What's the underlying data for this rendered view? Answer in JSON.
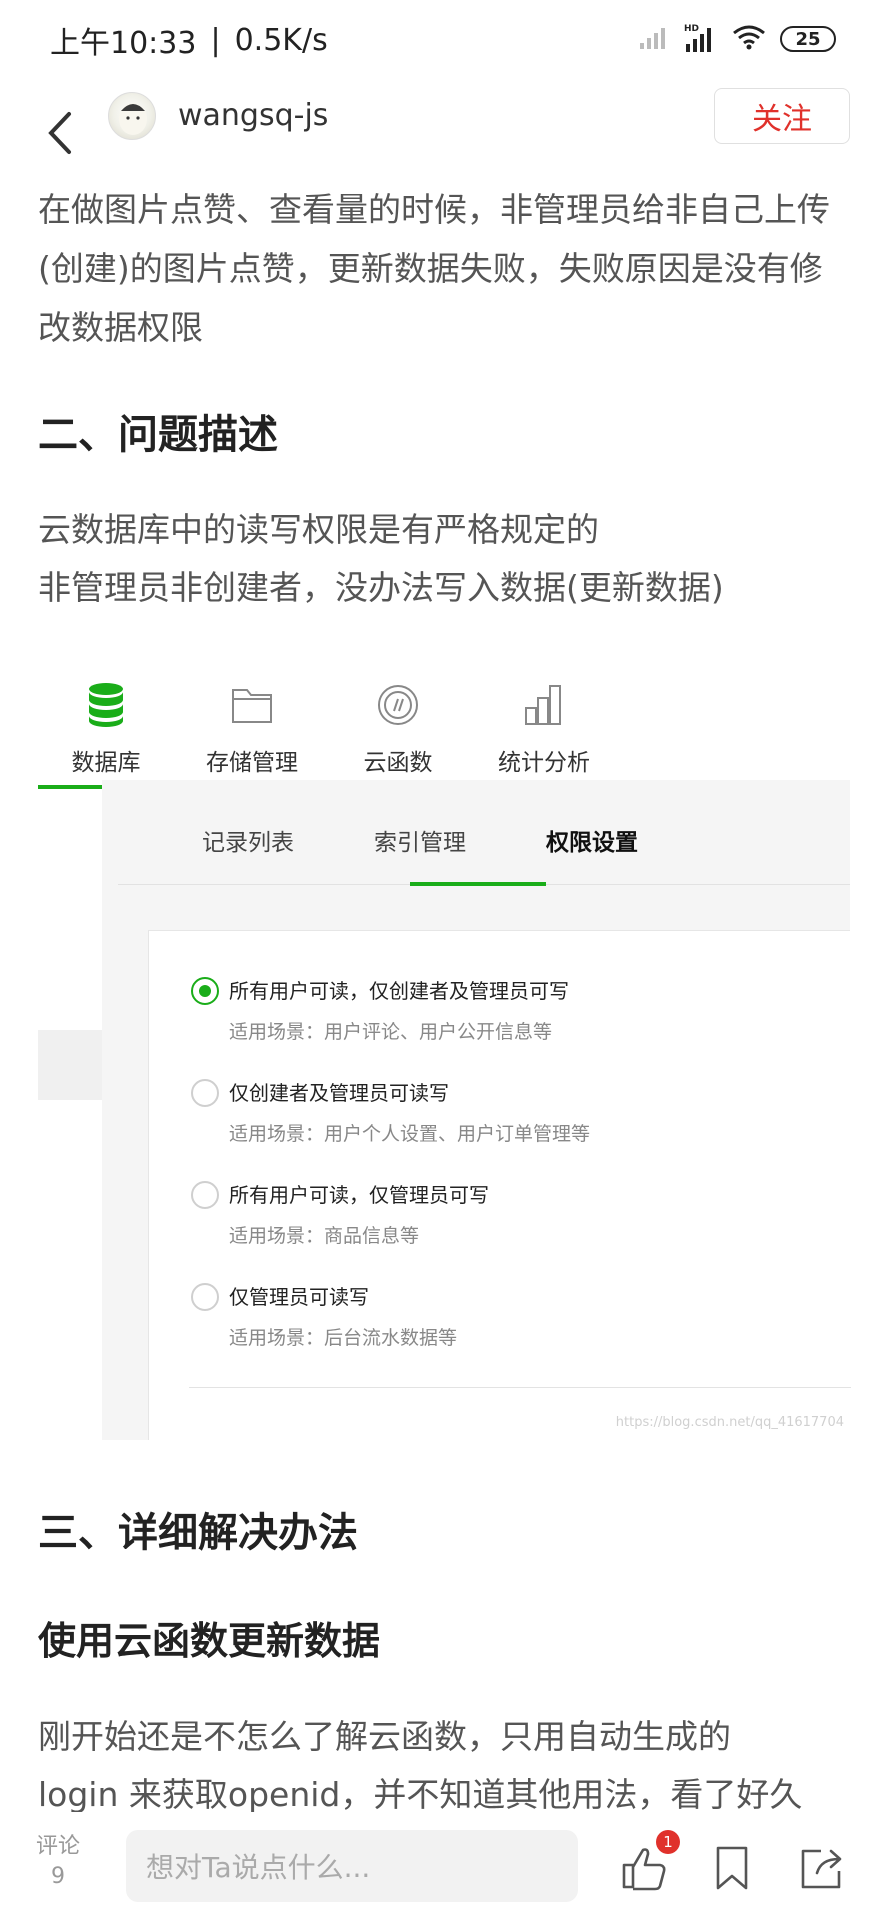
{
  "status_bar": {
    "time": "上午10:33",
    "separator": "|",
    "net_speed": "0.5K/s",
    "battery": "25",
    "icons": [
      "signal-icon",
      "hd-signal-icon",
      "wifi-icon",
      "battery-icon"
    ]
  },
  "header": {
    "username": "wangsq-js",
    "follow_label": "关注"
  },
  "article": {
    "intro": "在做图片点赞、查看量的时候，非管理员给非自己上传(创建)的图片点赞，更新数据失败，失败原因是没有修改数据权限",
    "section2_title": "二、问题描述",
    "section2_line1": "云数据库中的读写权限是有严格规定的",
    "section2_line2": "非管理员非创建者，没办法写入数据(更新数据)",
    "section3_title": "三、详细解决办法",
    "subsection_title": "使用云函数更新数据",
    "para_last_1": "刚开始还是不怎么了解云函数，只用自动生成的",
    "para_last_2": "login 来获取openid，并不知道其他用法，看了好久"
  },
  "embed": {
    "tabs": [
      {
        "label": "数据库",
        "icon": "database-icon",
        "active": true
      },
      {
        "label": "存储管理",
        "icon": "folder-icon",
        "active": false
      },
      {
        "label": "云函数",
        "icon": "cloud-function-icon",
        "active": false
      },
      {
        "label": "统计分析",
        "icon": "chart-icon",
        "active": false
      }
    ],
    "subtabs": [
      "记录列表",
      "索引管理",
      "权限设置"
    ],
    "options": [
      {
        "title": "所有用户可读，仅创建者及管理员可写",
        "sub": "适用场景：用户评论、用户公开信息等",
        "checked": true
      },
      {
        "title": "仅创建者及管理员可读写",
        "sub": "适用场景：用户个人设置、用户订单管理等",
        "checked": false
      },
      {
        "title": "所有用户可读，仅管理员可写",
        "sub": "适用场景：商品信息等",
        "checked": false
      },
      {
        "title": "仅管理员可读写",
        "sub": "适用场景：后台流水数据等",
        "checked": false
      }
    ],
    "watermark": "https://blog.csdn.net/qq_41617704"
  },
  "bottom_bar": {
    "comment_label": "评论",
    "comment_count": "9",
    "input_placeholder": "想对Ta说点什么...",
    "like_count": "1"
  },
  "colors": {
    "accent_green": "#1aad19",
    "follow_red": "#e0312b"
  }
}
